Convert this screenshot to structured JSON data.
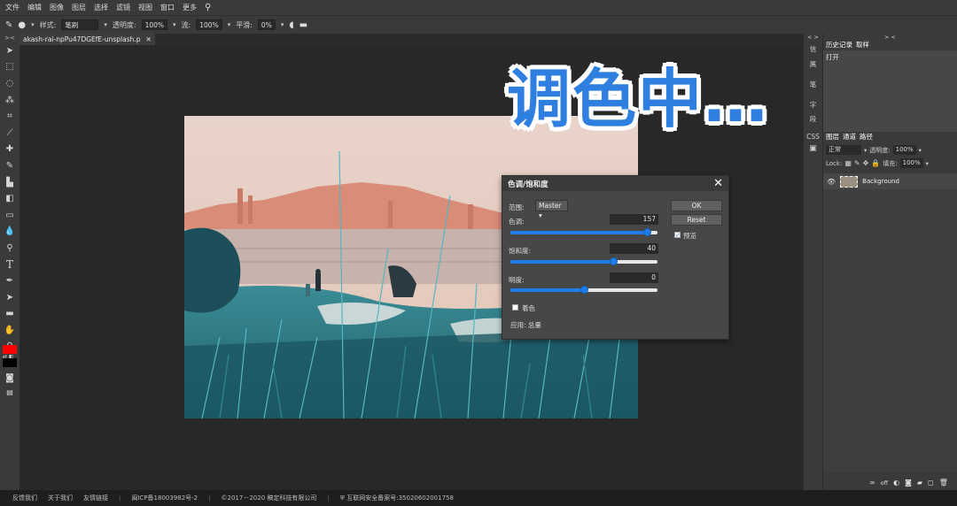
{
  "menu": {
    "items": [
      "文件",
      "编辑",
      "图像",
      "图层",
      "选择",
      "滤镜",
      "视图",
      "窗口",
      "更多"
    ]
  },
  "options": {
    "style_label": "样式:",
    "style_value": "笔刷",
    "opacity_label": "透明度:",
    "opacity_value": "100%",
    "flow_label": "流:",
    "flow_value": "100%",
    "smooth_label": "平滑:",
    "smooth_value": "0%"
  },
  "document": {
    "tab_title": "akash-rai-npPu47DGEfE-unsplash.p",
    "close": "✕"
  },
  "headline": "调色中…",
  "dialog": {
    "title": "色调/饱和度",
    "range_label": "范围:",
    "range_value": "Master",
    "hue_label": "色调:",
    "hue_value": "157",
    "hue_fraction": 0.93,
    "saturation_label": "饱和度:",
    "saturation_value": "40",
    "saturation_fraction": 0.7,
    "lightness_label": "明度:",
    "lightness_value": "0",
    "lightness_fraction": 0.5,
    "ok": "OK",
    "reset": "Reset",
    "preview_label": "预览",
    "preview_checked": true,
    "colorize_label": "着色",
    "colorize_checked": false,
    "apply_label": "应用: 总量"
  },
  "minicol": {
    "items": [
      "信",
      "属",
      "笔",
      "字",
      "段",
      "CSS"
    ],
    "toggle": "< >"
  },
  "history": {
    "tabs": [
      "历史记录",
      "取样"
    ],
    "items": [
      "打开"
    ]
  },
  "layers": {
    "tabs": [
      "图层",
      "通道",
      "路径"
    ],
    "blend_mode": "正常",
    "opacity_label": "透明度:",
    "opacity_value": "100%",
    "lock_label": "Lock:",
    "fill_label": "填充:",
    "fill_value": "100%",
    "layer_name": "Background",
    "footer_off": "off"
  },
  "footer": {
    "links": [
      "反馈我们",
      "关于我们",
      "友情链接"
    ],
    "icp": "闽ICP备18003982号-2",
    "copyright": "©2017－2020 稿定科技有限公司",
    "security": "互联网安全备案号:35020602001758"
  },
  "colors": {
    "accent": "#1e7de8",
    "foreground": "#ff0000",
    "background": "#000000",
    "headline": "#2f7fe0"
  }
}
